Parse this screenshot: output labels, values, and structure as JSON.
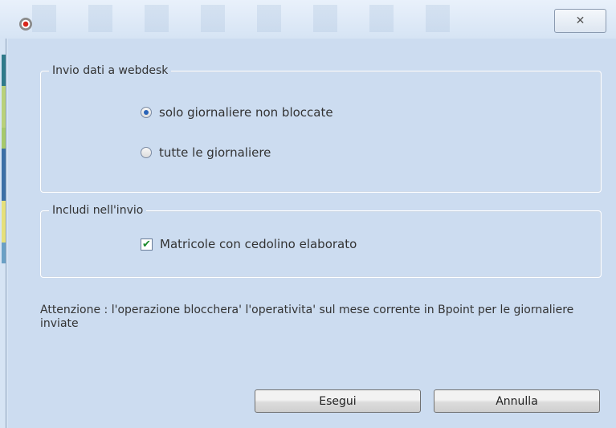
{
  "window": {
    "close_glyph": "✕",
    "app_icon": "app-record-icon"
  },
  "group_send": {
    "legend": "Invio dati a webdesk",
    "options": [
      {
        "label": "solo giornaliere non bloccate",
        "selected": true
      },
      {
        "label": "tutte le giornaliere",
        "selected": false
      }
    ]
  },
  "group_include": {
    "legend": "Includi nell'invio",
    "checkbox": {
      "label": "Matricole con cedolino elaborato",
      "checked": true,
      "mark": "✔"
    }
  },
  "note": "Attenzione : l'operazione blocchera' l'operativita' sul mese corrente in Bpoint per le giornaliere inviate",
  "buttons": {
    "execute": "Esegui",
    "cancel": "Annulla"
  }
}
